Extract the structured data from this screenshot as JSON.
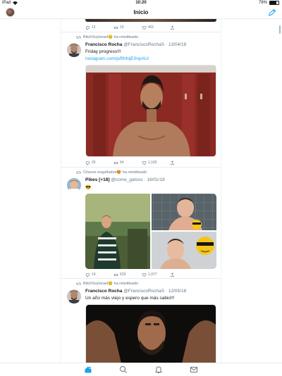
{
  "status": {
    "device": "iPad",
    "time": "10:20",
    "battery": "76%",
    "battery_level": 0.76
  },
  "header": {
    "title": "Inicio"
  },
  "prev_tweet": {
    "replies": "12",
    "retweets": "19",
    "likes": "401"
  },
  "tweets": [
    {
      "retweeted_by": "BitchSoyIsrael😏 ha retwitteado",
      "name": "Francisco Rocha",
      "handle": "@FranciscoRochaS",
      "date": "· 13/04/18",
      "text": "Friday progress!!!",
      "link": "instagram.com/p/BhhijE0npAU/",
      "replies": "25",
      "retweets": "54",
      "likes": "1,183"
    },
    {
      "retweeted_by": "Chavos engañados😍 ha retwitteado",
      "name": "Pibes [+18]",
      "handle": "@come_gatoss",
      "date": "· 16/01/18",
      "text": "😎",
      "replies": "14",
      "retweets": "629",
      "likes": "1,977"
    },
    {
      "retweeted_by": "BitchSoyIsrael😏 ha retwitteado",
      "name": "Francisco Rocha",
      "handle": "@FranciscoRochaS",
      "date": "· 12/05/18",
      "text": "Un año más viejo y espero que más sabio!!!"
    }
  ],
  "colors": {
    "accent": "#1da1f2",
    "text": "#14171a",
    "muted": "#657786",
    "divider": "#e6ecf0"
  },
  "tabs": [
    "home-icon",
    "search-icon",
    "notifications-icon",
    "messages-icon"
  ]
}
